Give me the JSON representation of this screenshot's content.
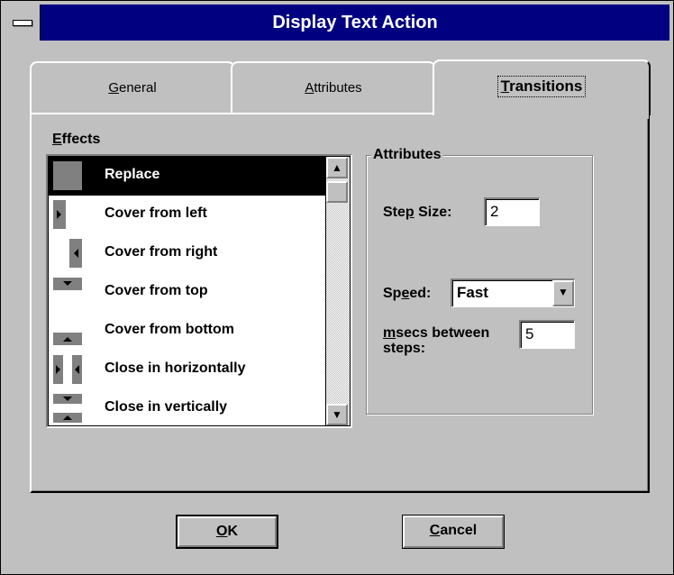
{
  "window": {
    "title": "Display Text Action"
  },
  "tabs": [
    {
      "label": "General",
      "mnemonic_index": 0
    },
    {
      "label": "Attributes",
      "mnemonic_index": 0
    },
    {
      "label": "Transitions",
      "mnemonic_index": 0,
      "active": true
    }
  ],
  "effects": {
    "label": "Effects",
    "items": [
      {
        "label": "Replace",
        "icon": "replace-icon",
        "selected": true
      },
      {
        "label": "Cover from left",
        "icon": "cover-left-icon"
      },
      {
        "label": "Cover from right",
        "icon": "cover-right-icon"
      },
      {
        "label": "Cover from top",
        "icon": "cover-top-icon"
      },
      {
        "label": "Cover from bottom",
        "icon": "cover-bottom-icon"
      },
      {
        "label": "Close in horizontally",
        "icon": "close-horizontal-icon"
      },
      {
        "label": "Close in vertically",
        "icon": "close-vertical-icon"
      }
    ]
  },
  "attributes": {
    "group_title": "Attributes",
    "step_size_label": "Step Size:",
    "step_size_value": "2",
    "speed_label": "Speed:",
    "speed_value": "Fast",
    "msecs_label_line1": "msecs between",
    "msecs_label_line2": "steps:",
    "msecs_value": "5"
  },
  "buttons": {
    "ok": "OK",
    "cancel": "Cancel"
  },
  "colors": {
    "titlebar": "#000080",
    "face": "#c0c0c0",
    "selection": "#000000"
  }
}
